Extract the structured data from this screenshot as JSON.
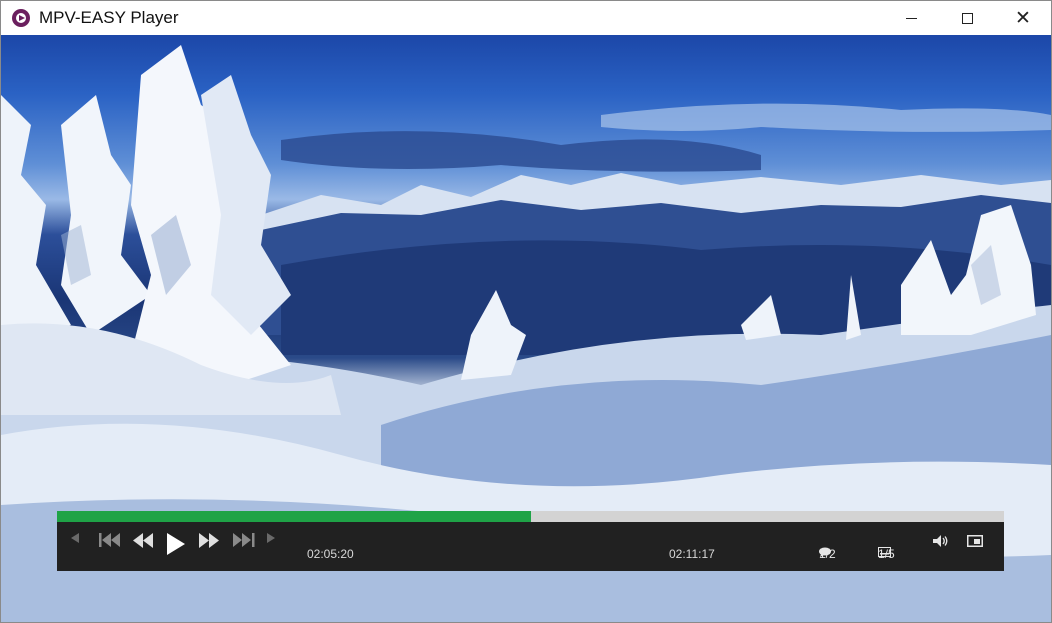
{
  "window": {
    "title": "MPV-EASY Player",
    "icon": "mpv-logo-icon",
    "controls": [
      "minimize",
      "maximize",
      "close"
    ]
  },
  "player": {
    "current_time": "02:05:20",
    "total_time": "02:11:17",
    "progress": 0.5,
    "subtitle_track": "1/2",
    "audio_track": "1/5",
    "buttons": [
      "prev-chapter",
      "skip-to-start",
      "rewind",
      "play",
      "fast-forward",
      "skip-to-end",
      "next-chapter",
      "volume",
      "fullscreen"
    ],
    "colors": {
      "progress_fill": "#1fa347",
      "progress_track": "#d3d3d3",
      "control_bar": "#212121"
    }
  }
}
